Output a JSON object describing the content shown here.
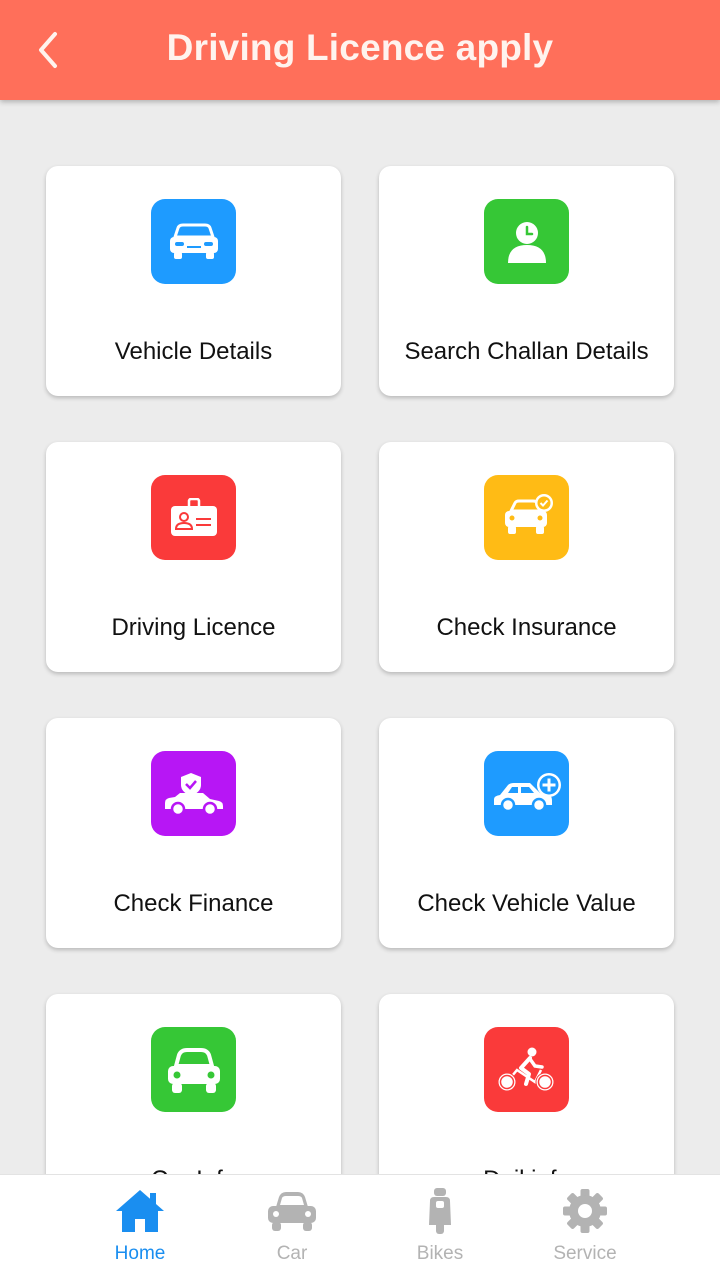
{
  "header": {
    "title": "Driving Licence apply",
    "back_icon": "chevron-left-icon"
  },
  "cards": [
    {
      "label": "Vehicle Details",
      "icon": "car-front-icon",
      "color": "#1e9bff"
    },
    {
      "label": "Search Challan Details",
      "icon": "user-clock-icon",
      "color": "#36c736"
    },
    {
      "label": "Driving Licence",
      "icon": "id-card-icon",
      "color": "#fa3a3a"
    },
    {
      "label": "Check Insurance",
      "icon": "car-check-icon",
      "color": "#ffbb15"
    },
    {
      "label": "Check Finance",
      "icon": "car-shield-icon",
      "color": "#b716f5"
    },
    {
      "label": "Check Vehicle Value",
      "icon": "car-plus-icon",
      "color": "#1e9bff"
    },
    {
      "label": "Car Info",
      "icon": "car-icon",
      "color": "#36c736"
    },
    {
      "label": "Dail info",
      "icon": "bicycle-icon",
      "color": "#fa3a3a"
    }
  ],
  "bottom_nav": [
    {
      "label": "Home",
      "icon": "home-icon",
      "active": true
    },
    {
      "label": "Car",
      "icon": "car-icon",
      "active": false
    },
    {
      "label": "Bikes",
      "icon": "scooter-icon",
      "active": false
    },
    {
      "label": "Service",
      "icon": "gear-icon",
      "active": false
    }
  ],
  "colors": {
    "header_bg": "#ff6f5a",
    "nav_active": "#1a8ef0",
    "nav_inactive": "#b3b3b3",
    "page_bg": "#ececec"
  }
}
